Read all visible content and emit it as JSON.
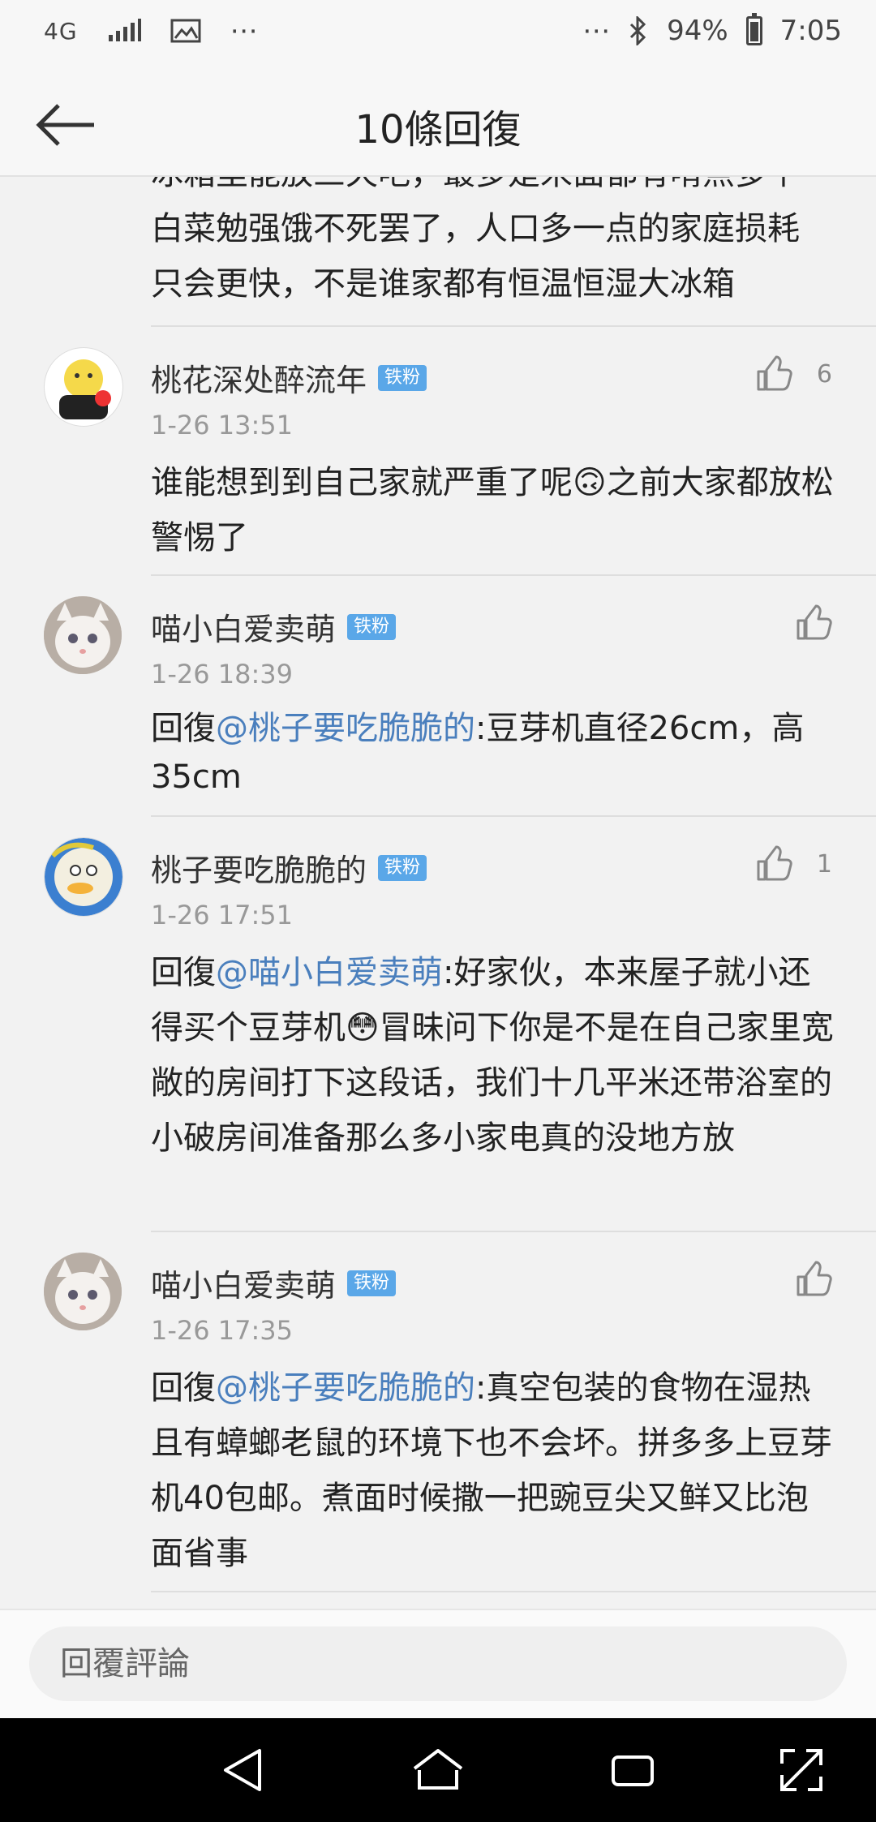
{
  "status_bar": {
    "network": "4G",
    "battery_percent": "94%",
    "time": "7:05",
    "icons": [
      "signal-icon",
      "image-icon",
      "more-icon",
      "bluetooth-icon",
      "battery-icon"
    ]
  },
  "header": {
    "title": "10條回復",
    "back_icon": "back-arrow-icon"
  },
  "top_partial_text": {
    "line1": "冰箱里能放三天吧，最多是米面都有啃点多个",
    "line2": "白菜勉强饿不死罢了，人口多一点的家庭损耗",
    "line3": "只会更快，不是谁家都有恒温恒湿大冰箱"
  },
  "comments": [
    {
      "username": "桃花深处醉流年",
      "badge": "铁粉",
      "time": "1-26 13:51",
      "likes": "6",
      "text_before": "谁能想到到自己家就严重了呢",
      "emoji": "🙃",
      "text_after": "之前大家都放松警惕了"
    },
    {
      "username": "喵小白爱卖萌",
      "badge": "铁粉",
      "time": "1-26 18:39",
      "likes": "",
      "reply_prefix": "回復",
      "mention": "@桃子要吃脆脆的",
      "text": ":豆芽机直径26cm，高35cm"
    },
    {
      "username": "桃子要吃脆脆的",
      "badge": "铁粉",
      "time": "1-26 17:51",
      "likes": "1",
      "reply_prefix": "回復",
      "mention": "@喵小白爱卖萌",
      "text_before": ":好家伙，本来屋子就小还得买个豆芽机",
      "emoji": "😳",
      "text_after": "冒昧问下你是不是在自己家里宽敞的房间打下这段话，我们十几平米还带浴室的小破房间准备那么多小家电真的没地方放"
    },
    {
      "username": "喵小白爱卖萌",
      "badge": "铁粉",
      "time": "1-26 17:35",
      "likes": "",
      "reply_prefix": "回復",
      "mention": "@桃子要吃脆脆的",
      "text": ":真空包装的食物在湿热且有蟑螂老鼠的环境下也不会坏。拼多多上豆芽机40包邮。煮面时候撒一把豌豆尖又鲜又比泡面省事"
    }
  ],
  "reply_bar": {
    "placeholder": "回覆評論"
  },
  "nav_bar": {
    "icons": [
      "back-triangle-icon",
      "home-icon",
      "recents-icon",
      "screenshot-icon"
    ]
  },
  "colors": {
    "mention": "#4a7fbd",
    "badge": "#5aa7e8"
  }
}
